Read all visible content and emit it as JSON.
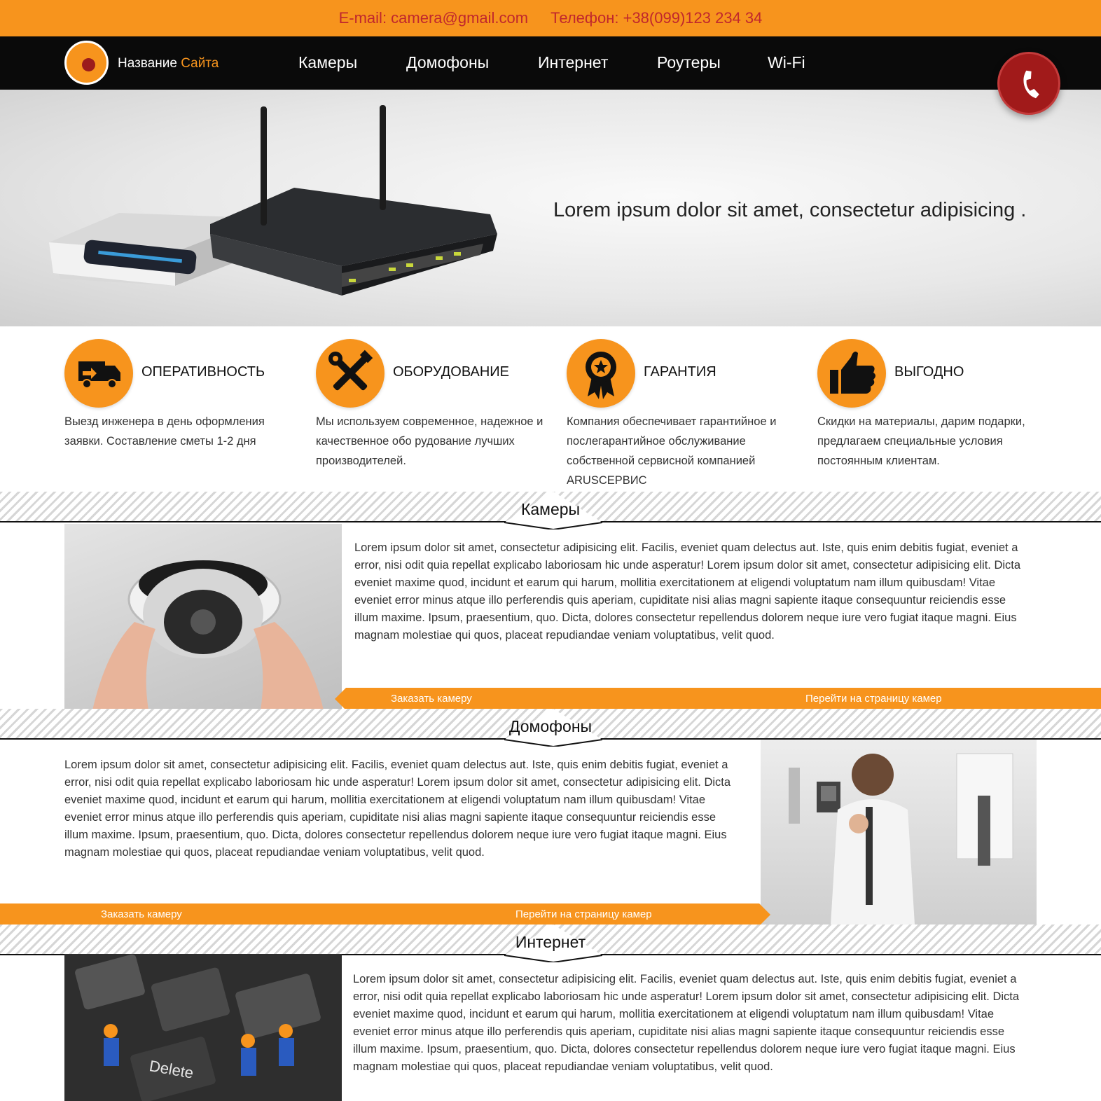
{
  "colors": {
    "accent": "#f7941d",
    "dark_red": "#9b1c1c",
    "nav_bg": "#0a0a0a"
  },
  "topbar": {
    "email": "E-mail: camera@gmail.com",
    "phone": "Телефон: +38(099)123 234 34"
  },
  "logo": {
    "part1": "Название ",
    "part2": "Сайта"
  },
  "nav": {
    "items": [
      "Камеры",
      "Домофоны",
      "Интернет",
      "Роутеры",
      "Wi-Fi"
    ],
    "phone_icon": "phone-icon"
  },
  "hero": {
    "text": "Lorem ipsum dolor sit amet, consectetur adipisicing ."
  },
  "features": [
    {
      "icon": "truck-icon",
      "title": "ОПЕРАТИВНОСТЬ",
      "text": "Выезд инженера в день оформления заявки. Составление сметы 1-2 дня"
    },
    {
      "icon": "tools-icon",
      "title": "ОБОРУДОВАНИЕ",
      "text": "Мы используем современное, надежное и качественное обо рудование лучших производителей."
    },
    {
      "icon": "award-icon",
      "title": "ГАРАНТИЯ",
      "text": "Компания обеспечивает гарантийное и послегарантийное обслуживание собственной сервисной компанией ARUSСЕРВИС"
    },
    {
      "icon": "thumbs-up-icon",
      "title": "ВЫГОДНО",
      "text": "Скидки на материалы, дарим подарки, предлагаем специальные условия постоянным клиентам."
    }
  ],
  "sections": [
    {
      "title": "Камеры",
      "text": "Lorem ipsum dolor sit amet, consectetur adipisicing elit. Facilis, eveniet quam delectus aut. Iste, quis enim debitis fugiat, eveniet a error, nisi odit quia repellat explicabo laboriosam hic unde asperatur! Lorem ipsum dolor sit amet, consectetur adipisicing elit. Dicta eveniet maxime quod, incidunt et earum qui harum, mollitia exercitationem at eligendi voluptatum nam illum quibusdam! Vitae eveniet error minus atque illo perferendis quis aperiam, cupiditate nisi alias magni sapiente itaque consequuntur reiciendis esse illum maxime. Ipsum, praesentium, quo. Dicta, dolores consectetur repellendus dolorem neque iure vero fugiat itaque magni. Eius magnam molestiae qui quos, placeat repudiandae veniam voluptatibus, velit quod.",
      "btn_order": "Заказать камеру",
      "btn_more": "Перейти на страницу камер"
    },
    {
      "title": "Домофоны",
      "text": "Lorem ipsum dolor sit amet, consectetur adipisicing elit. Facilis, eveniet quam delectus aut. Iste, quis enim debitis fugiat, eveniet a error, nisi odit quia repellat explicabo laboriosam hic unde asperatur! Lorem ipsum dolor sit amet, consectetur adipisicing elit. Dicta eveniet maxime quod, incidunt et earum qui harum, mollitia exercitationem at eligendi voluptatum nam illum quibusdam! Vitae eveniet error minus atque illo perferendis quis aperiam, cupiditate nisi alias magni sapiente itaque consequuntur reiciendis esse illum maxime. Ipsum, praesentium, quo. Dicta, dolores consectetur repellendus dolorem neque iure vero fugiat itaque magni. Eius magnam molestiae qui quos, placeat repudiandae veniam voluptatibus, velit quod.",
      "btn_order": "Заказать камеру",
      "btn_more": "Перейти на страницу камер"
    },
    {
      "title": "Интернет",
      "text": "Lorem ipsum dolor sit amet, consectetur adipisicing elit. Facilis, eveniet quam delectus aut. Iste, quis enim debitis fugiat, eveniet a error, nisi odit quia repellat explicabo laboriosam hic unde asperatur! Lorem ipsum dolor sit amet, consectetur adipisicing elit. Dicta eveniet maxime quod, incidunt et earum qui harum, mollitia exercitationem at eligendi voluptatum nam illum quibusdam! Vitae eveniet error minus atque illo perferendis quis aperiam, cupiditate nisi alias magni sapiente itaque consequuntur reiciendis esse illum maxime. Ipsum, praesentium, quo. Dicta, dolores consectetur repellendus dolorem neque iure vero fugiat itaque magni. Eius magnam molestiae qui quos, placeat repudiandae veniam voluptatibus, velit quod.",
      "photo_key_label": "Delete"
    }
  ]
}
